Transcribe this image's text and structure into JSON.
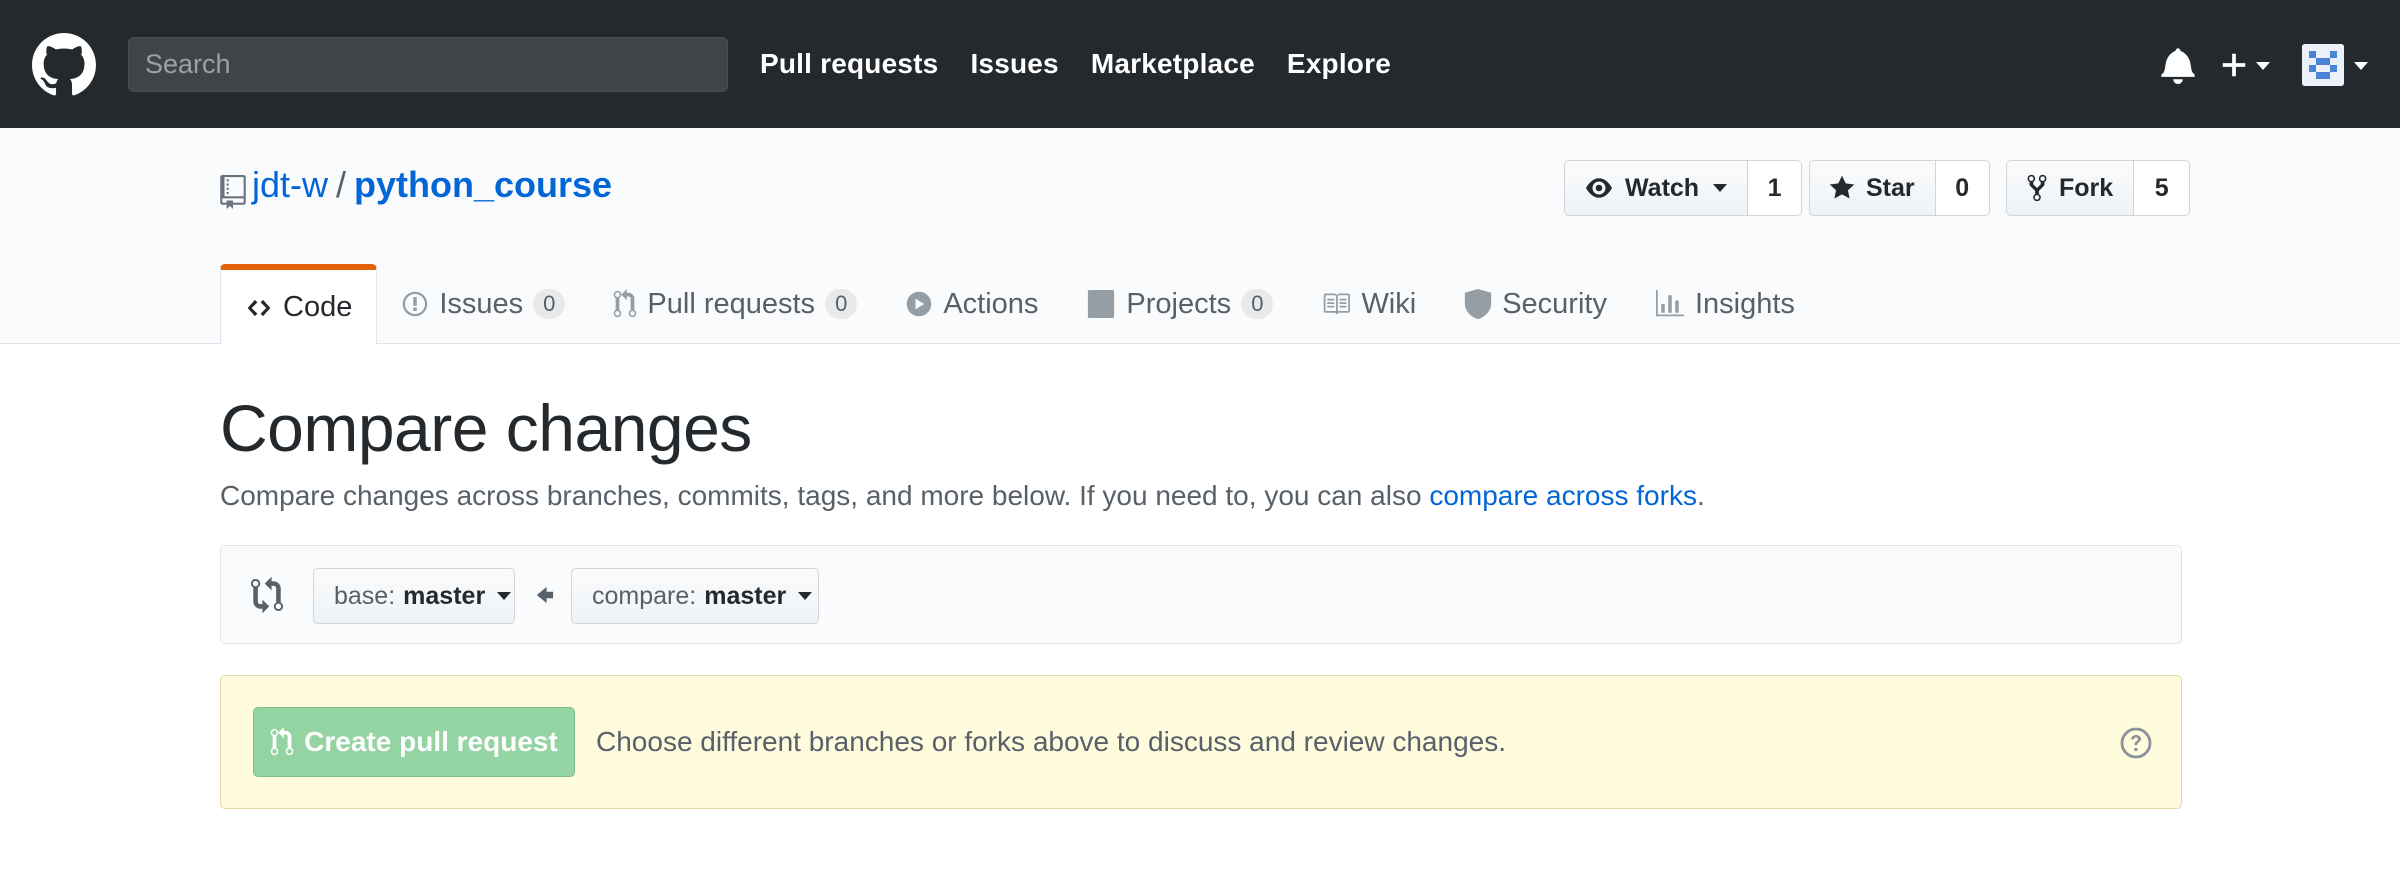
{
  "header": {
    "search_placeholder": "Search",
    "nav": [
      "Pull requests",
      "Issues",
      "Marketplace",
      "Explore"
    ]
  },
  "repo": {
    "owner": "jdt-w",
    "separator": "/",
    "name": "python_course",
    "watch": {
      "label": "Watch",
      "count": "1"
    },
    "star": {
      "label": "Star",
      "count": "0"
    },
    "fork": {
      "label": "Fork",
      "count": "5"
    }
  },
  "tabs": [
    {
      "label": "Code",
      "icon": "code-icon"
    },
    {
      "label": "Issues",
      "count": "0",
      "icon": "issue-opened-icon"
    },
    {
      "label": "Pull requests",
      "count": "0",
      "icon": "git-pull-request-icon"
    },
    {
      "label": "Actions",
      "icon": "play-icon"
    },
    {
      "label": "Projects",
      "count": "0",
      "icon": "project-icon"
    },
    {
      "label": "Wiki",
      "icon": "book-icon"
    },
    {
      "label": "Security",
      "icon": "shield-icon"
    },
    {
      "label": "Insights",
      "icon": "graph-icon"
    }
  ],
  "compare": {
    "title": "Compare changes",
    "subtitle": "Compare changes across branches, commits, tags, and more below. If you need to, you can also",
    "subtitle_link": "compare across forks",
    "subtitle_end": ".",
    "base_prefix": "base:",
    "base_branch": "master",
    "compare_prefix": "compare:",
    "compare_branch": "master"
  },
  "flash": {
    "button": "Create pull request",
    "message": "Choose different branches or forks above to discuss and review changes."
  },
  "colors": {
    "header_bg": "#24292e",
    "link": "#0366d6",
    "tab_accent": "#e36209",
    "flash_bg": "#fffbdd",
    "pr_button": "#94d3a2"
  }
}
